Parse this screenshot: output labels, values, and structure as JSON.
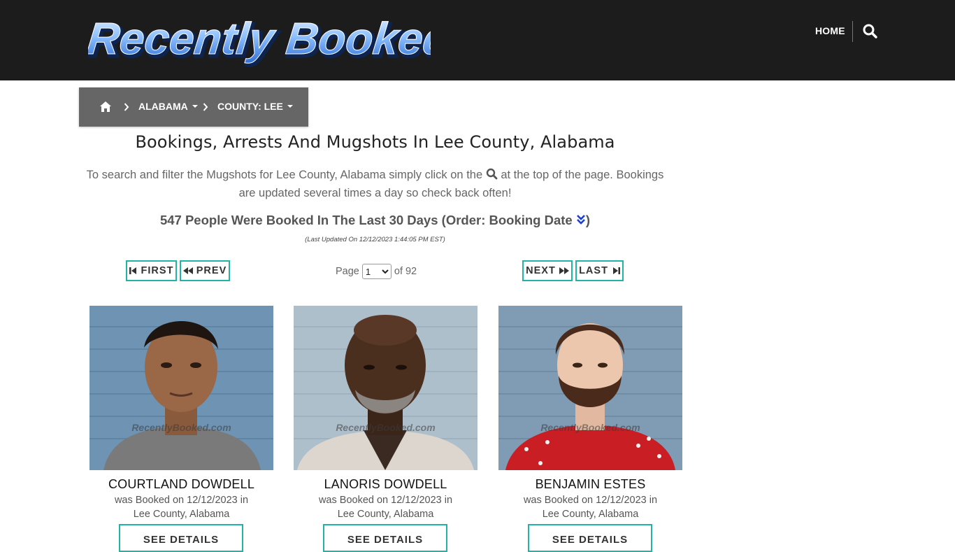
{
  "header": {
    "logo_text": "Recently Booked",
    "nav_home": "HOME",
    "search_icon": "search-icon"
  },
  "breadcrumb": {
    "home_icon": "home-icon",
    "state": "ALABAMA",
    "county": "COUNTY: LEE"
  },
  "main": {
    "title": "Bookings, Arrests And Mugshots In Lee County, Alabama",
    "intro_before": "To search and filter the Mugshots for Lee County, Alabama simply click on the",
    "intro_after": "at the top of the page. Bookings are updated several times a day so check back often!",
    "count_text": "547 People Were Booked In The Last 30 Days (Order: Booking Date",
    "count_close": ")",
    "last_updated": "(Last Updated On 12/12/2023 1:44:05 PM EST)"
  },
  "pagination": {
    "first": "FIRST",
    "prev": "PREV",
    "next": "NEXT",
    "last": "LAST",
    "page_label": "Page",
    "page_value": "1",
    "of_label": "of 92"
  },
  "bookings": [
    {
      "name": "COURTLAND DOWDELL",
      "line1": "was Booked on 12/12/2023 in",
      "line2": "Lee County, Alabama",
      "button": "SEE DETAILS",
      "watermark": "RecentlyBooked.com"
    },
    {
      "name": "LANORIS DOWDELL",
      "line1": "was Booked on 12/12/2023 in",
      "line2": "Lee County, Alabama",
      "button": "SEE DETAILS",
      "watermark": "RecentlyBooked.com"
    },
    {
      "name": "BENJAMIN ESTES",
      "line1": "was Booked on 12/12/2023 in",
      "line2": "Lee County, Alabama",
      "button": "SEE DETAILS",
      "watermark": "RecentlyBooked.com"
    }
  ],
  "colors": {
    "header_bg": "#1c1c1c",
    "breadcrumb_bg": "#666666",
    "accent": "#22b3a7",
    "sort_icon": "#1a3fd6"
  }
}
